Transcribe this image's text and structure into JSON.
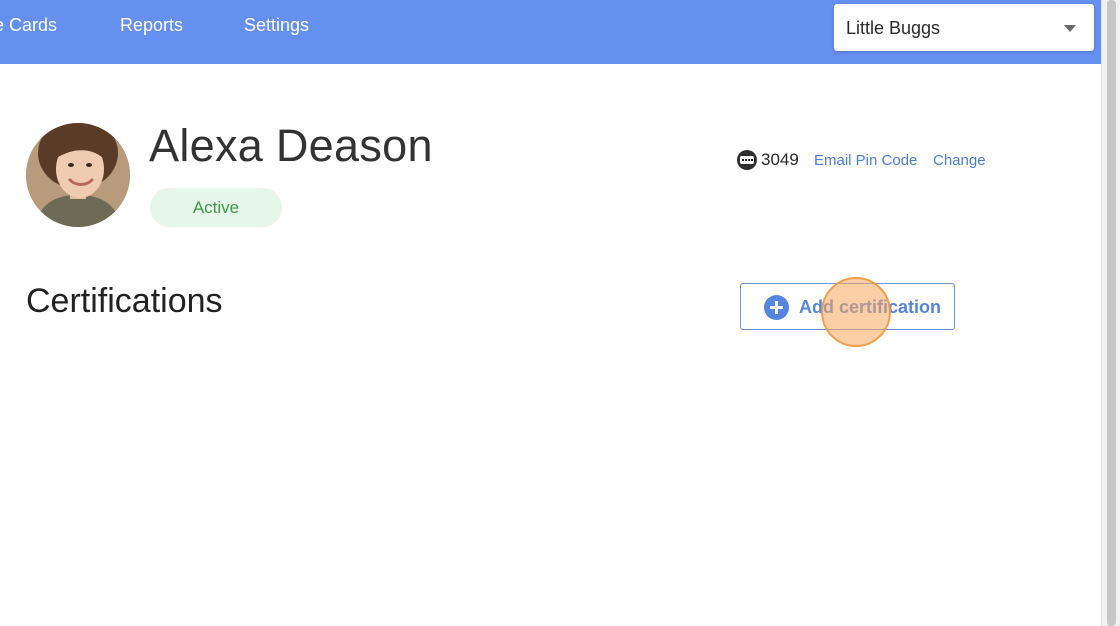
{
  "nav": {
    "items": [
      {
        "label": "e Cards"
      },
      {
        "label": "Reports"
      },
      {
        "label": "Settings"
      }
    ],
    "location_select": {
      "value": "Little Buggs"
    }
  },
  "employee": {
    "name": "Alexa Deason",
    "status": "Active",
    "pin_code": "3049",
    "email_pin_label": "Email Pin Code",
    "change_label": "Change"
  },
  "certifications": {
    "title": "Certifications",
    "add_button_label": "Add certification"
  },
  "colors": {
    "nav_bar": "#6690f0",
    "accent_blue": "#5585e0",
    "status_badge_bg": "#e6f6e8",
    "status_badge_text": "#3f9a4c",
    "click_highlight": "#f7a65b"
  },
  "icons": {
    "dropdown": "chevron-down-icon",
    "pin": "pin-code-icon",
    "add": "plus-circle-icon"
  }
}
